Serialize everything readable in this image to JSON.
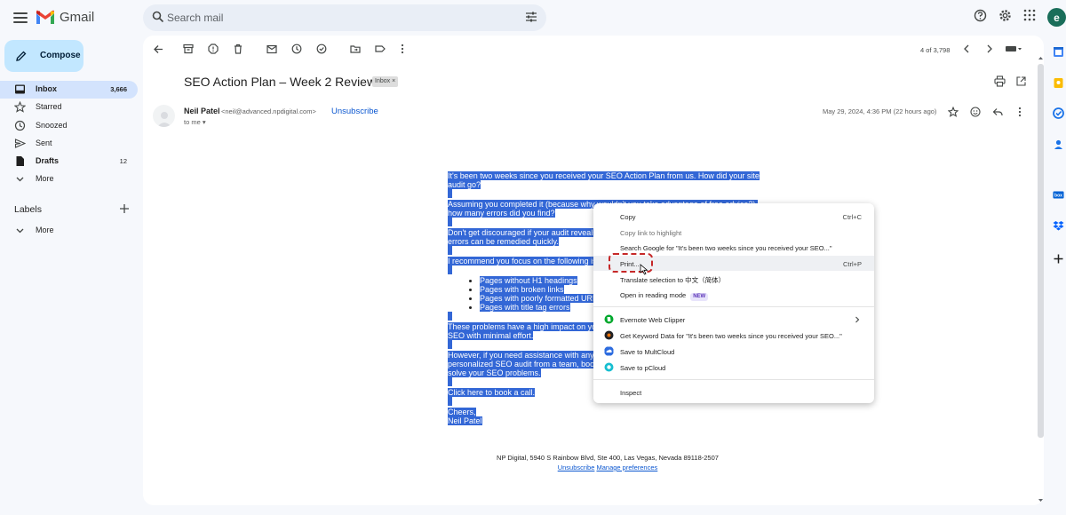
{
  "app": {
    "name": "Gmail",
    "avatar_letter": "e"
  },
  "search": {
    "placeholder": "Search mail"
  },
  "sidebar": {
    "compose_label": "Compose",
    "items": [
      {
        "label": "Inbox",
        "count": "3,666"
      },
      {
        "label": "Starred",
        "count": ""
      },
      {
        "label": "Snoozed",
        "count": ""
      },
      {
        "label": "Sent",
        "count": ""
      },
      {
        "label": "Drafts",
        "count": "12"
      },
      {
        "label": "More",
        "count": ""
      }
    ],
    "labels_heading": "Labels",
    "labels_more": "More"
  },
  "toolbar": {
    "pager": "4 of 3,798"
  },
  "message": {
    "subject": "SEO Action Plan – Week 2 Review",
    "chip": "Inbox",
    "chip_close": "×",
    "sender_name": "Neil Patel",
    "sender_email": "<neil@advanced.npdigital.com>",
    "unsubscribe": "Unsubscribe",
    "to": "to me",
    "date": "May 29, 2024, 4:36 PM (22 hours ago)"
  },
  "body": {
    "p1": "It's been two weeks since you received your SEO Action Plan from us. How did your site audit go?",
    "p2": "Assuming you completed it (because why wouldn't you take advantage of free advice?), how many errors did you find?",
    "p3": "Don't get discouraged if your audit reveals more errors than you anticipated. Many SEO errors can be remedied quickly.",
    "p4": "I recommend you focus on the following issues first:",
    "bullets": [
      "Pages without H1 headings",
      "Pages with broken links",
      "Pages with poorly formatted URLs",
      "Pages with title tag errors"
    ],
    "p5": "These problems have a high impact on your rankings, so fixing them will improve your SEO with minimal effort.",
    "p6": "However, if you need assistance with any of these issues or would rather get a personalized SEO audit from a team, book a call with one of our experts. They'll help you solve your SEO problems.",
    "p7_prefix": "Click ",
    "p7_link": "here",
    "p7_suffix": " to book a call.",
    "sign1": "Cheers,",
    "sign2": "Neil Patel"
  },
  "footer": {
    "address": "NP Digital, 5940 S Rainbow Blvd, Ste 400, Las Vegas, Nevada 89118-2507",
    "unsubscribe": "Unsubscribe",
    "manage": "Manage preferences"
  },
  "context_menu": {
    "copy": "Copy",
    "copy_short": "Ctrl+C",
    "copy_link": "Copy link to highlight",
    "search_google": "Search Google for \"It's been two weeks since you received your SEO...\"",
    "print": "Print...",
    "print_short": "Ctrl+P",
    "translate": "Translate selection to 中文（简体）",
    "reading": "Open in reading mode",
    "new_badge": "NEW",
    "evernote": "Evernote Web Clipper",
    "keyword": "Get Keyword Data for \"It's been two weeks since you received your SEO...\"",
    "multcloud": "Save to MultCloud",
    "pcloud": "Save to pCloud",
    "inspect": "Inspect"
  },
  "colors": {
    "accent": "#0b57d0",
    "selection": "#3367d6",
    "compose_bg": "#c2e7ff",
    "highlight_border": "#c62828"
  }
}
